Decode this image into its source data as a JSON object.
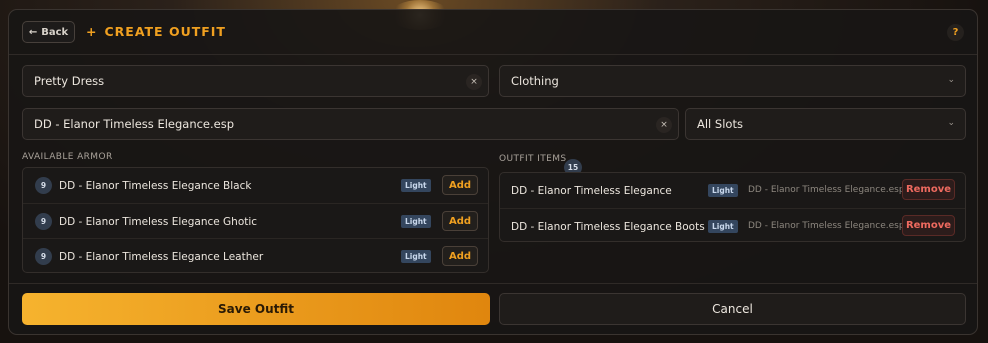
{
  "header": {
    "back_label": "Back",
    "title_icon": "+",
    "title": "CREATE OUTFIT",
    "help_label": "?"
  },
  "form": {
    "outfit_name": "Pretty Dress",
    "category": "Clothing",
    "plugin_filter": "DD - Elanor Timeless Elegance.esp",
    "slot_filter": "All Slots",
    "clear_glyph": "×",
    "chevron_glyph": "⌄"
  },
  "available": {
    "label": "AVAILABLE ARMOR",
    "items": [
      {
        "badge": "9",
        "name": "DD - Elanor Timeless Elegance Black",
        "tag": "Light",
        "action": "Add"
      },
      {
        "badge": "9",
        "name": "DD - Elanor Timeless Elegance Ghotic",
        "tag": "Light",
        "action": "Add"
      },
      {
        "badge": "9",
        "name": "DD - Elanor Timeless Elegance Leather",
        "tag": "Light",
        "action": "Add"
      }
    ]
  },
  "outfit": {
    "label": "OUTFIT ITEMS",
    "count": "15",
    "items": [
      {
        "name": "DD - Elanor Timeless Elegance",
        "tag": "Light",
        "source": "DD - Elanor Timeless Elegance.esp",
        "action": "Remove"
      },
      {
        "name": "DD - Elanor Timeless Elegance Boots",
        "tag": "Light",
        "source": "DD - Elanor Timeless Elegance.esp",
        "action": "Remove"
      }
    ]
  },
  "footer": {
    "save_label": "Save Outfit",
    "cancel_label": "Cancel"
  },
  "colors": {
    "accent": "#f0a020",
    "danger": "#ee6a5f",
    "tag_bg": "#34465e"
  }
}
